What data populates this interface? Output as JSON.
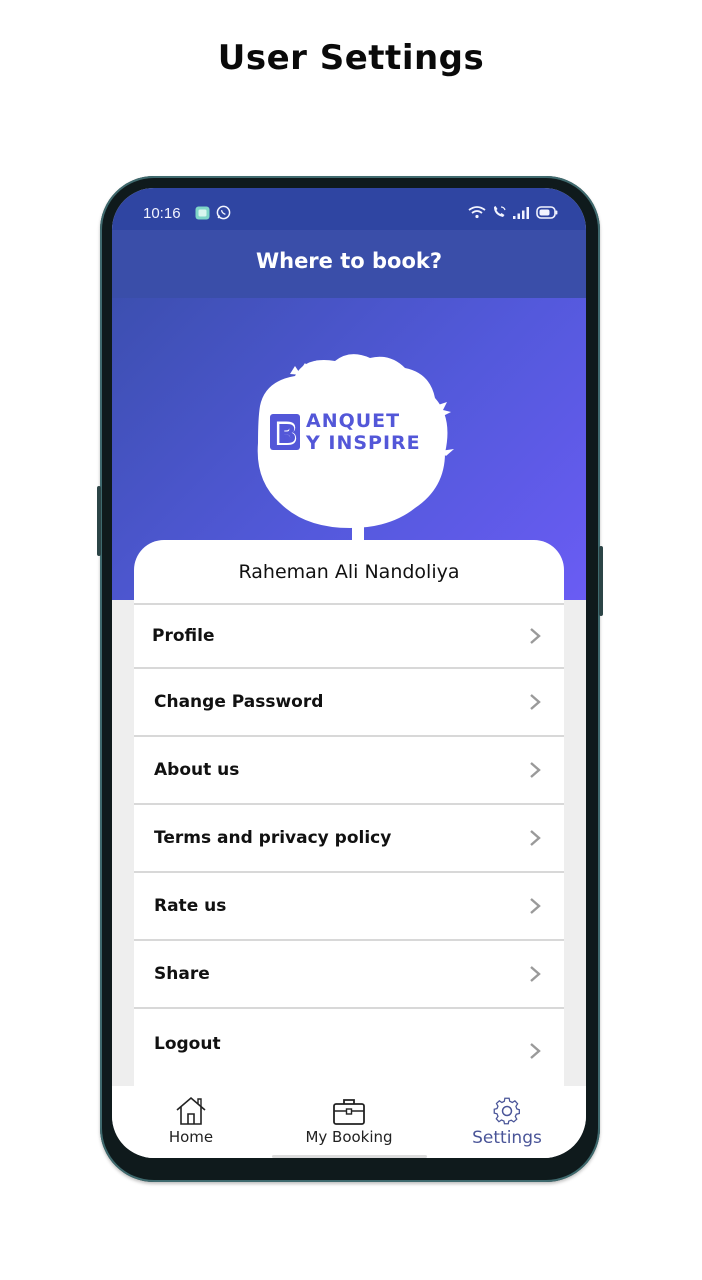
{
  "page": {
    "heading": "User Settings"
  },
  "status_bar": {
    "time": "10:16",
    "left_icons": [
      "message-app-icon",
      "whatsapp-icon"
    ],
    "right_icons": [
      "wifi-icon",
      "wifi-call-icon",
      "signal-icon",
      "battery-icon"
    ]
  },
  "app_bar": {
    "title": "Where to book?"
  },
  "hero": {
    "logo_line1": "ANQUET",
    "logo_line2": "Y INSPIRE",
    "logo_initial": "B",
    "brand_color": "#5357d8"
  },
  "profile": {
    "user_name": "Raheman Ali Nandoliya"
  },
  "menu": {
    "items": [
      {
        "label": "Profile",
        "icon": "chevron-right-icon"
      },
      {
        "label": "Change Password",
        "icon": "chevron-right-icon"
      },
      {
        "label": "About us",
        "icon": "chevron-right-icon"
      },
      {
        "label": "Terms and privacy policy",
        "icon": "chevron-right-icon"
      },
      {
        "label": "Rate us",
        "icon": "chevron-right-icon"
      },
      {
        "label": "Share",
        "icon": "chevron-right-icon"
      },
      {
        "label": "Logout",
        "icon": "chevron-right-icon"
      }
    ]
  },
  "bottom_nav": {
    "items": [
      {
        "label": "Home",
        "icon": "home-icon",
        "active": false
      },
      {
        "label": "My Booking",
        "icon": "briefcase-icon",
        "active": false
      },
      {
        "label": "Settings",
        "icon": "gear-icon",
        "active": true
      }
    ],
    "active_color": "#4a5598"
  },
  "colors": {
    "status_bar": "#2f45a2",
    "app_bar": "#3a4ea9",
    "hero_gradient_start": "#3c4fb0",
    "hero_gradient_end": "#6a5cf4",
    "chevron": "#9a9a9a"
  }
}
